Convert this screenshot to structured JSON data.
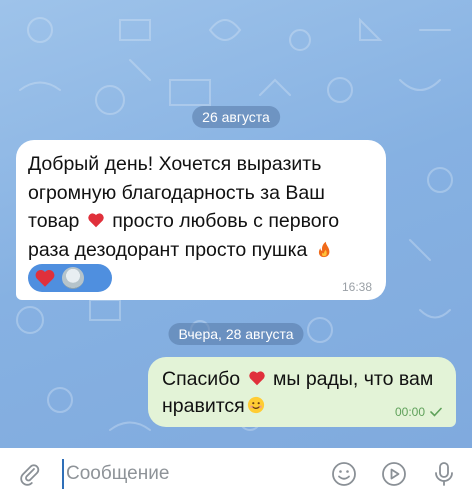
{
  "chat": {
    "date_1": "26 августа",
    "incoming": {
      "lines": [
        "Добрый день! Хочется выразить",
        "огромную благодарность за Ваш",
        "товар",
        "просто любовь с первого",
        "раза дезодорант просто пушка"
      ],
      "time": "16:38",
      "reactions": [
        "heart-reaction-icon",
        "user-avatar"
      ]
    },
    "date_2": "Вчера, 28 августа",
    "outgoing": {
      "line_1_a": "Спасибо",
      "line_1_b": "мы рады, что вам",
      "line_2": "нравится",
      "time": "00:00",
      "status": "sent-check-icon"
    }
  },
  "composer": {
    "placeholder": "Сообщение",
    "icons": [
      "attach-icon",
      "emoji-icon",
      "send-video-icon",
      "microphone-icon"
    ]
  },
  "colors": {
    "background": "#86b1e2",
    "incoming_bubble": "#ffffff",
    "outgoing_bubble": "#e3f3d7",
    "accent": "#2f6fb8",
    "reaction_pill": "#4f8fdf"
  }
}
